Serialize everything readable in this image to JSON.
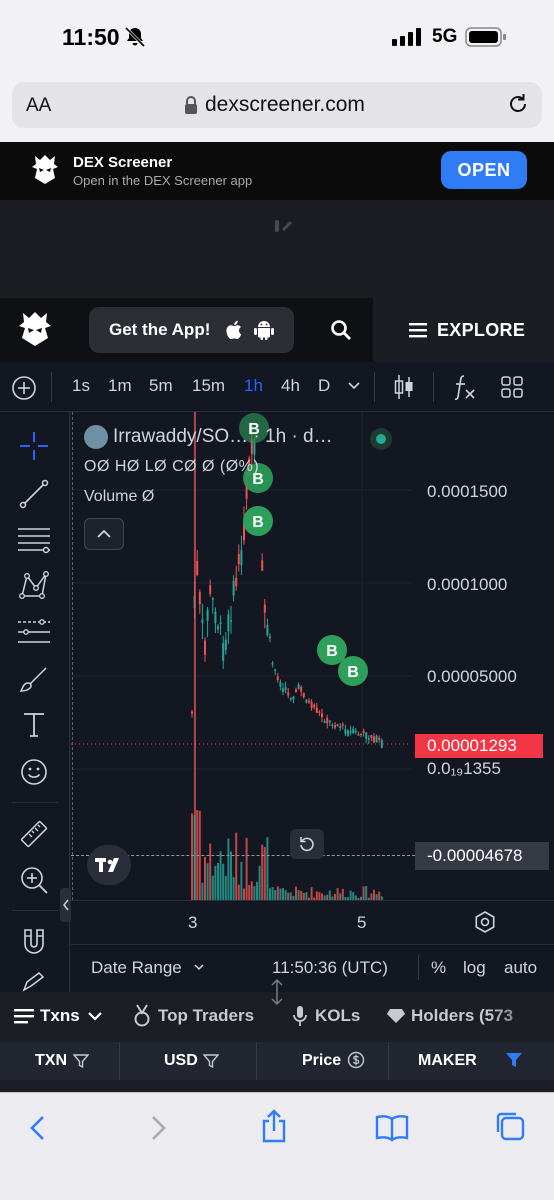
{
  "status": {
    "time": "11:50",
    "network": "5G"
  },
  "browser": {
    "text_size_label": "AA",
    "url": "dexscreener.com"
  },
  "app_banner": {
    "title": "DEX Screener",
    "subtitle": "Open in the DEX Screener app",
    "open_label": "OPEN"
  },
  "header": {
    "get_app_label": "Get the App!",
    "explore_label": "EXPLORE"
  },
  "toolbar": {
    "timeframes": [
      "1s",
      "1m",
      "5m",
      "15m",
      "1h",
      "4h",
      "D"
    ],
    "active_timeframe": "1h"
  },
  "chart": {
    "legend_title": "Irrawaddy/SO… · 1h · d…",
    "legend_ohlc": "OØ HØ LØ CØ Ø (Ø%)",
    "legend_volume": "Volume  Ø",
    "y_ticks": [
      "0.0001500",
      "0.0001000",
      "0.00005000",
      "0.0₁₉1355"
    ],
    "current_price": "0.00001293",
    "crosshair_price": "-0.00004678",
    "x_ticks": [
      "3",
      "5"
    ],
    "marker_label": "B",
    "date_range_label": "Date Range",
    "clock": "11:50:36 (UTC)",
    "percent_label": "%",
    "log_label": "log",
    "auto_label": "auto",
    "colors": {
      "up": "#26a69a",
      "down": "#ef5350",
      "marker": "#2e9e5b",
      "price": "#f23645"
    }
  },
  "tabs": {
    "txns": "Txns",
    "top_traders": "Top Traders",
    "kols": "KOLs",
    "holders": "Holders (573"
  },
  "table": {
    "headers": [
      "TXN",
      "USD",
      "Price",
      "MAKER"
    ]
  }
}
